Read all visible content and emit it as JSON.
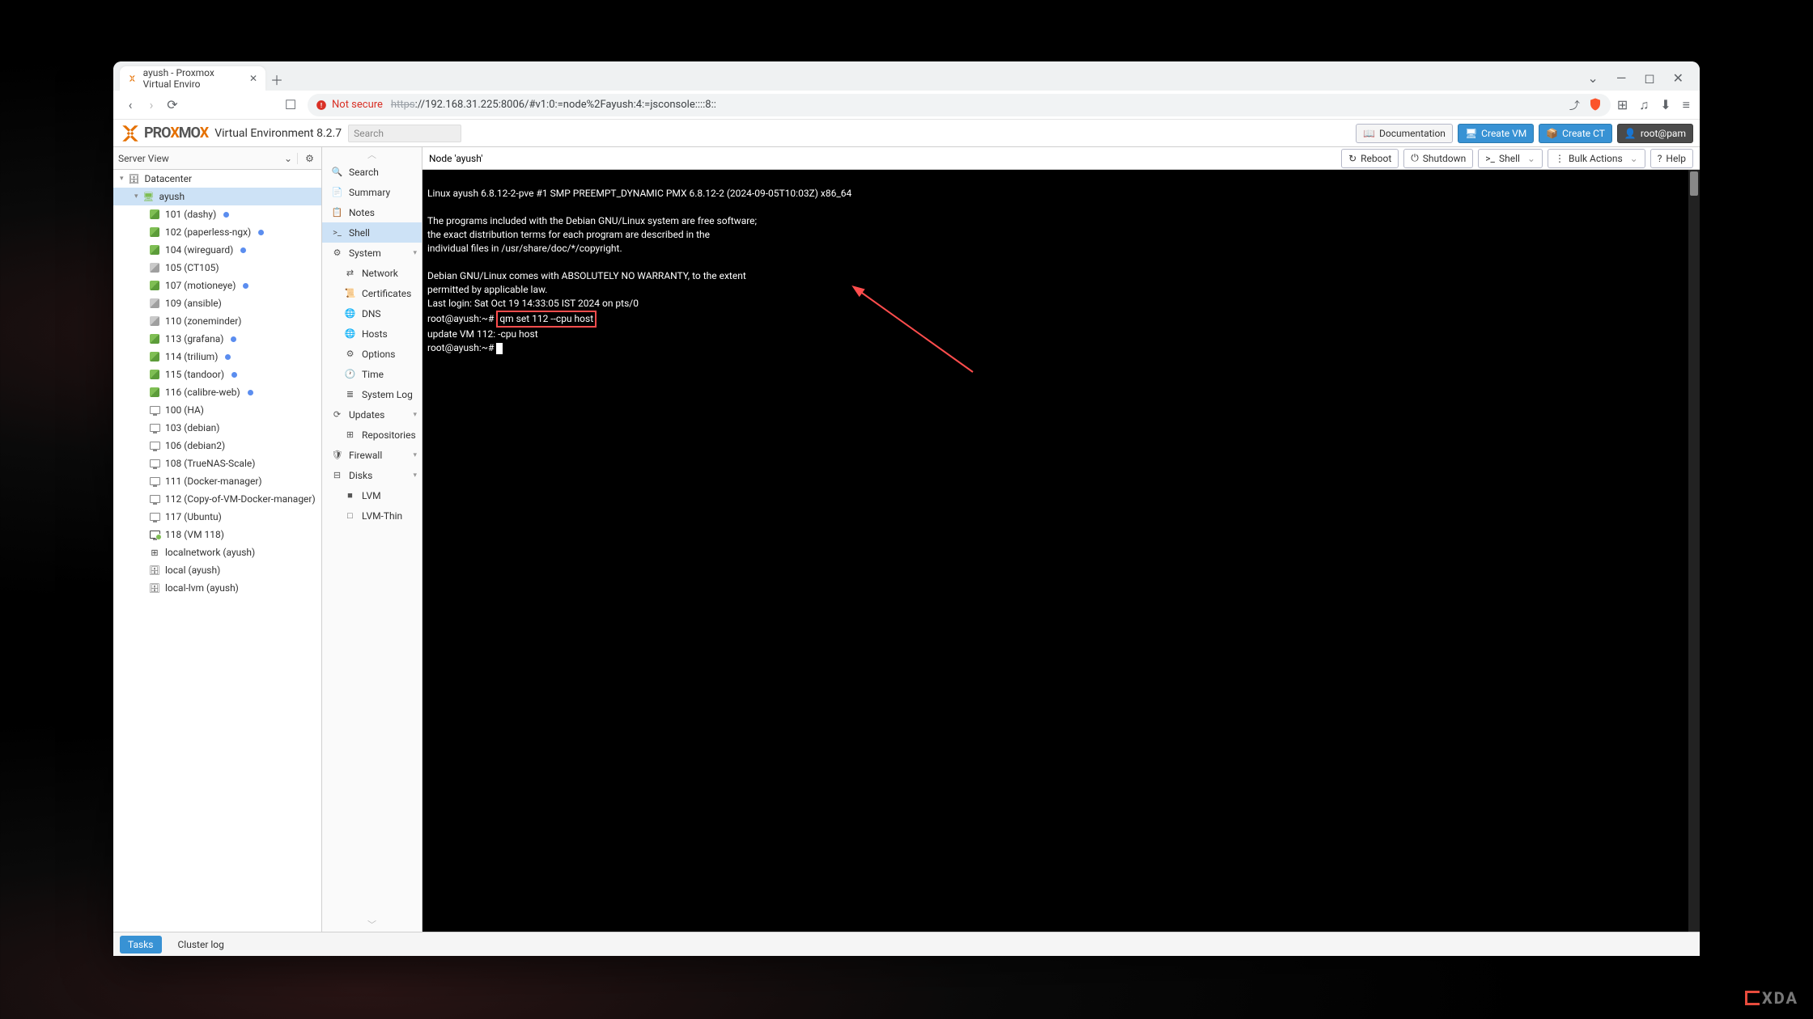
{
  "browser": {
    "tab_title": "ayush - Proxmox Virtual Enviro",
    "url_prefix": "https",
    "url": "://192.168.31.225:8006/#v1:0:=node%2Fayush:4:=jsconsole::::8::",
    "not_secure": "Not secure"
  },
  "px": {
    "brand": "PROXMOX",
    "ver": "Virtual Environment 8.2.7",
    "search_ph": "Search",
    "doc": "Documentation",
    "create_vm": "Create VM",
    "create_ct": "Create CT",
    "user": "root@pam"
  },
  "treehdr": "Server View",
  "tree": [
    {
      "l": 1,
      "ico": "dc",
      "t": "Datacenter"
    },
    {
      "l": 2,
      "ico": "node",
      "t": "ayush",
      "sel": true
    },
    {
      "l": 3,
      "ico": "lxc",
      "t": "101 (dashy)",
      "dot": "blue"
    },
    {
      "l": 3,
      "ico": "lxc",
      "t": "102 (paperless-ngx)",
      "dot": "blue"
    },
    {
      "l": 3,
      "ico": "lxc",
      "t": "104 (wireguard)",
      "dot": "blue"
    },
    {
      "l": 3,
      "ico": "lxc-off",
      "t": "105 (CT105)"
    },
    {
      "l": 3,
      "ico": "lxc",
      "t": "107 (motioneye)",
      "dot": "blue"
    },
    {
      "l": 3,
      "ico": "lxc-off",
      "t": "109 (ansible)"
    },
    {
      "l": 3,
      "ico": "lxc-off",
      "t": "110 (zoneminder)"
    },
    {
      "l": 3,
      "ico": "lxc",
      "t": "113 (grafana)",
      "dot": "blue"
    },
    {
      "l": 3,
      "ico": "lxc",
      "t": "114 (trilium)",
      "dot": "blue"
    },
    {
      "l": 3,
      "ico": "lxc",
      "t": "115 (tandoor)",
      "dot": "blue"
    },
    {
      "l": 3,
      "ico": "lxc",
      "t": "116 (calibre-web)",
      "dot": "blue"
    },
    {
      "l": 3,
      "ico": "vm",
      "t": "100 (HA)"
    },
    {
      "l": 3,
      "ico": "vm",
      "t": "103 (debian)"
    },
    {
      "l": 3,
      "ico": "vm",
      "t": "106 (debian2)"
    },
    {
      "l": 3,
      "ico": "vm",
      "t": "108 (TrueNAS-Scale)"
    },
    {
      "l": 3,
      "ico": "vm",
      "t": "111 (Docker-manager)"
    },
    {
      "l": 3,
      "ico": "vm",
      "t": "112 (Copy-of-VM-Docker-manager)"
    },
    {
      "l": 3,
      "ico": "vm",
      "t": "117 (Ubuntu)"
    },
    {
      "l": 3,
      "ico": "vm-on",
      "t": "118 (VM 118)"
    },
    {
      "l": 3,
      "ico": "net",
      "t": "localnetwork (ayush)"
    },
    {
      "l": 3,
      "ico": "stor",
      "t": "local (ayush)"
    },
    {
      "l": 3,
      "ico": "stor",
      "t": "local-lvm (ayush)"
    }
  ],
  "node_label": "Node 'ayush'",
  "topbtns": {
    "reboot": "Reboot",
    "shutdown": "Shutdown",
    "shell": "Shell",
    "bulk": "Bulk Actions",
    "help": "Help"
  },
  "mid": [
    {
      "t": "Search",
      "ico": "🔍"
    },
    {
      "t": "Summary",
      "ico": "📄"
    },
    {
      "t": "Notes",
      "ico": "📋"
    },
    {
      "t": "Shell",
      "ico": ">_",
      "sel": true
    },
    {
      "t": "System",
      "ico": "⚙",
      "exp": true
    },
    {
      "t": "Network",
      "ico": "⇄",
      "sub": true
    },
    {
      "t": "Certificates",
      "ico": "📜",
      "sub": true
    },
    {
      "t": "DNS",
      "ico": "🌐",
      "sub": true
    },
    {
      "t": "Hosts",
      "ico": "🌐",
      "sub": true
    },
    {
      "t": "Options",
      "ico": "⚙",
      "sub": true
    },
    {
      "t": "Time",
      "ico": "🕐",
      "sub": true
    },
    {
      "t": "System Log",
      "ico": "≣",
      "sub": true
    },
    {
      "t": "Updates",
      "ico": "⟳",
      "exp": true
    },
    {
      "t": "Repositories",
      "ico": "⊞",
      "sub": true
    },
    {
      "t": "Firewall",
      "ico": "🛡",
      "exp": true
    },
    {
      "t": "Disks",
      "ico": "⊟",
      "exp": true
    },
    {
      "t": "LVM",
      "ico": "■",
      "sub": true
    },
    {
      "t": "LVM-Thin",
      "ico": "□",
      "sub": true
    }
  ],
  "term": {
    "l1": "Linux ayush 6.8.12-2-pve #1 SMP PREEMPT_DYNAMIC PMX 6.8.12-2 (2024-09-05T10:03Z) x86_64",
    "l2": "",
    "l3": "The programs included with the Debian GNU/Linux system are free software;",
    "l4": "the exact distribution terms for each program are described in the",
    "l5": "individual files in /usr/share/doc/*/copyright.",
    "l6": "",
    "l7": "Debian GNU/Linux comes with ABSOLUTELY NO WARRANTY, to the extent",
    "l8": "permitted by applicable law.",
    "l9": "Last login: Sat Oct 19 14:33:05 IST 2024 on pts/0",
    "l10p": "root@ayush:~# ",
    "l10c": "qm set 112 --cpu host",
    "l11": "update VM 112: -cpu host",
    "l12": "root@ayush:~# "
  },
  "bottom": {
    "tasks": "Tasks",
    "cluster": "Cluster log"
  },
  "xda": "XDA"
}
